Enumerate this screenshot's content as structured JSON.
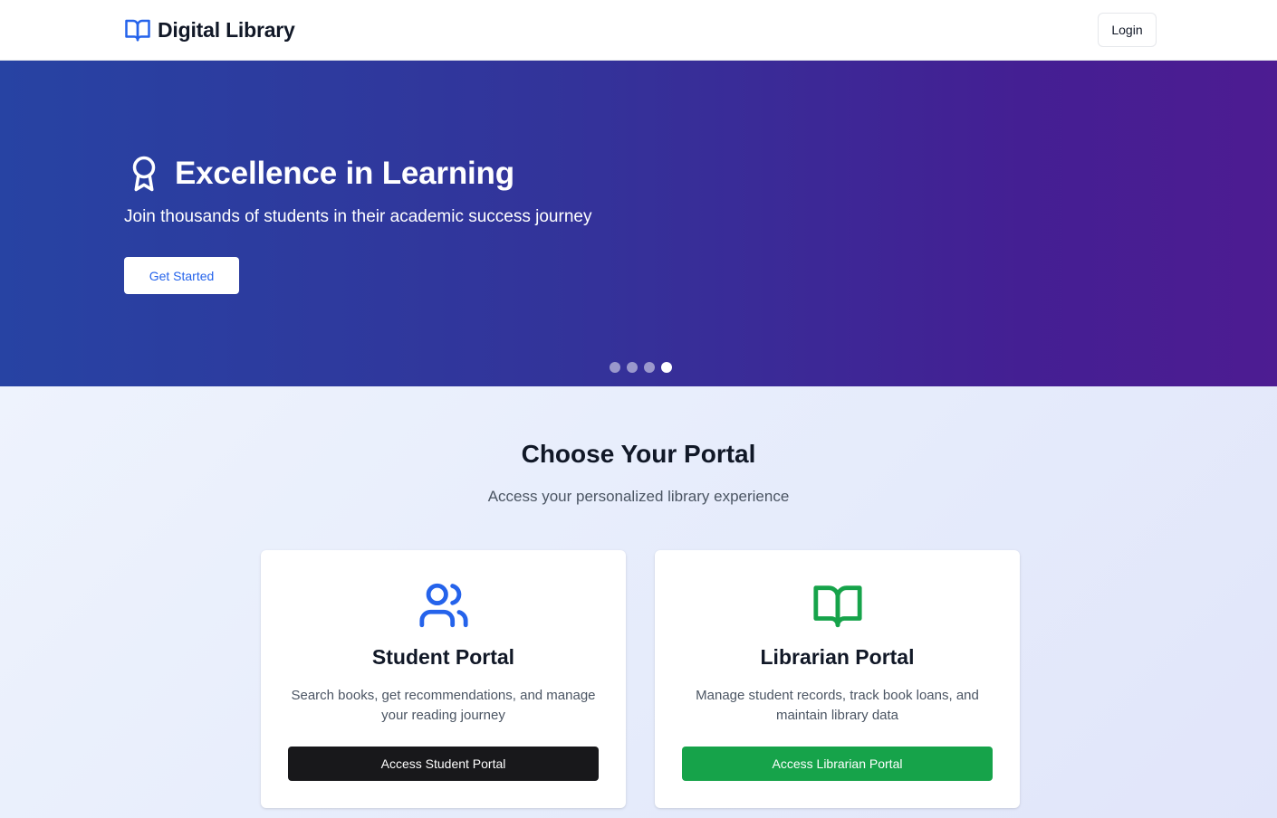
{
  "header": {
    "brand_title": "Digital Library",
    "brand_icon": "book-open-icon",
    "login_label": "Login"
  },
  "hero": {
    "icon": "award-icon",
    "title": "Excellence in Learning",
    "subtitle": "Join thousands of students in their academic success journey",
    "cta_label": "Get Started",
    "slides_total": 4,
    "active_slide": 4
  },
  "portals": {
    "title": "Choose Your Portal",
    "subtitle": "Access your personalized library experience",
    "cards": [
      {
        "icon": "users-icon",
        "icon_color": "#2563eb",
        "title": "Student Portal",
        "description": "Search books, get recommendations, and manage your reading journey",
        "button_label": "Access Student Portal",
        "button_color": "#18181b"
      },
      {
        "icon": "book-open-icon",
        "icon_color": "#16a34a",
        "title": "Librarian Portal",
        "description": "Manage student records, track book loans, and maintain library data",
        "button_label": "Access Librarian Portal",
        "button_color": "#16a34a"
      }
    ]
  },
  "colors": {
    "accent_blue": "#2563eb",
    "accent_green": "#16a34a",
    "hero_gradient_start": "#2743a3",
    "hero_gradient_end": "#4d1c92"
  }
}
